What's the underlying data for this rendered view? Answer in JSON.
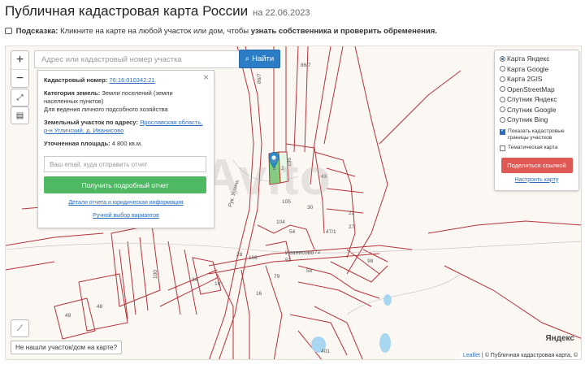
{
  "header": {
    "title": "Публичная кадастровая карта России",
    "date": "на 22.06.2023",
    "hint_label": "Подсказка:",
    "hint_text": "Кликните на карте на любой участок или дом, чтобы",
    "hint_bold": "узнать собственника и проверить обременения."
  },
  "search": {
    "placeholder": "Адрес или кадастровый номер участка",
    "button_label": "Найти"
  },
  "zoom": {
    "in": "+",
    "out": "−"
  },
  "info": {
    "cad_label": "Кадастровый номер:",
    "cad_value": "76:16:010342:21",
    "category_label": "Категория земель:",
    "category_value": "Земли поселений (земли населенных пунктов)",
    "category_use": "Для ведения личного подсобного хозяйства",
    "address_label": "Земельный участок по адресу:",
    "address_value": "Ярославская область, р-н Угличский, д. Иванисово",
    "area_label": "Уточненная площадь:",
    "area_value": "4 800 кв.м.",
    "email_placeholder": "Ваш email, куда отправить отчет",
    "report_button": "Получить подробный отчет",
    "details_link": "Детали отчета и юридическая информация",
    "manual_link": "Ручной выбор вариантов"
  },
  "layers": {
    "options": [
      {
        "label": "Карта Яндекс",
        "selected": true
      },
      {
        "label": "Карта Google",
        "selected": false
      },
      {
        "label": "Карта 2GIS",
        "selected": false
      },
      {
        "label": "OpenStreetMap",
        "selected": false
      },
      {
        "label": "Спутник Яндекс",
        "selected": false
      },
      {
        "label": "Спутник Google",
        "selected": false
      },
      {
        "label": "Спутник Bing",
        "selected": false
      }
    ],
    "show_borders": "Показать кадастровые границы участков",
    "thematic": "Тематическая карта",
    "share_button": "Поделиться ссылкой",
    "settings_link": "Настроить карту"
  },
  "map": {
    "not_found_button": "Не нашли участок/дом на карте?",
    "yandex_label": "Яндекс",
    "attribution_leaflet": "Leaflet",
    "attribution_sep": "|",
    "attribution_copy": "© Публичная кадастровая карта, ©",
    "watermark": "Avito",
    "labels": [
      "86/7",
      "86/7",
      "2",
      "2",
      "106",
      "105",
      "43",
      "30",
      "104",
      "54",
      "27",
      "23",
      "47/1",
      "98",
      "79",
      "49",
      "48",
      "16",
      "401",
      "100",
      "108",
      "53",
      "72",
      "28",
      "10",
      "34",
      "58"
    ],
    "road_label": "Рук. Угличь",
    "village_label": "Иванисово"
  },
  "colors": {
    "accent_blue": "#2d7dc6",
    "report_green": "#4fb862",
    "share_red": "#e05a55",
    "parcel_line": "#b5333a",
    "parcel_selected": "#7dd87a"
  }
}
